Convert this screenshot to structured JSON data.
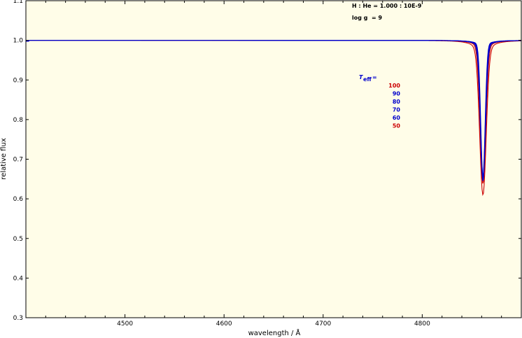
{
  "chart_data": {
    "type": "line",
    "xlabel": "wavelength / Å",
    "ylabel": "relative flux",
    "xlim": [
      4400,
      4900
    ],
    "ylim": [
      0.3,
      1.1
    ],
    "xticks": [
      4500,
      4600,
      4700,
      4800
    ],
    "yticks": [
      0.3,
      0.4,
      0.5,
      0.6,
      0.7,
      0.8,
      0.9,
      1.0,
      1.1
    ],
    "grid": false,
    "background_color": "#fffde8",
    "annotations": {
      "abundance": "H : He = 1.000 : 10E-9",
      "logg_label": "log g",
      "logg_value": "= 9",
      "teff_label": "T",
      "teff_sub": "eff",
      "teff_eq": "="
    },
    "line_center": 4861.3,
    "series": [
      {
        "name": "100",
        "color": "#cc0000",
        "min_flux": 0.66,
        "width": 2.2,
        "wing": 0.022
      },
      {
        "name": "90",
        "color": "#0000cc",
        "min_flux": 0.662,
        "width": 2.0,
        "wing": 0.018
      },
      {
        "name": "80",
        "color": "#0000cc",
        "min_flux": 0.662,
        "width": 1.9,
        "wing": 0.016
      },
      {
        "name": "70",
        "color": "#0000cc",
        "min_flux": 0.665,
        "width": 1.8,
        "wing": 0.014
      },
      {
        "name": "60",
        "color": "#0000cc",
        "min_flux": 0.668,
        "width": 1.7,
        "wing": 0.012
      },
      {
        "name": "50",
        "color": "#cc0000",
        "min_flux": 0.645,
        "width": 2.5,
        "wing": 0.035
      }
    ]
  }
}
